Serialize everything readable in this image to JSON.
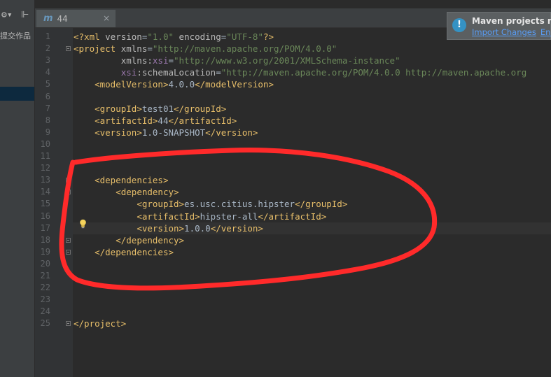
{
  "left_panel": {
    "label": "提交作品",
    "gear_icon": "gear-icon",
    "pin_icon": "pin-icon"
  },
  "tab": {
    "icon_letter": "m",
    "label": "44",
    "close_symbol": "×"
  },
  "notification": {
    "title": "Maven projects ne",
    "import_link": "Import Changes",
    "enable_link": "Ena"
  },
  "lines": [
    {
      "n": "1",
      "segs": [
        {
          "c": "t-pi",
          "t": "<?xml "
        },
        {
          "c": "t-attr",
          "t": "version"
        },
        {
          "c": "t-text",
          "t": "="
        },
        {
          "c": "t-val",
          "t": "\"1.0\""
        },
        {
          "c": "t-text",
          "t": " "
        },
        {
          "c": "t-attr",
          "t": "encoding"
        },
        {
          "c": "t-text",
          "t": "="
        },
        {
          "c": "t-val",
          "t": "\"UTF-8\""
        },
        {
          "c": "t-pi",
          "t": "?>"
        }
      ]
    },
    {
      "n": "2",
      "segs": [
        {
          "c": "t-tag",
          "t": "<project "
        },
        {
          "c": "t-attr",
          "t": "xmlns"
        },
        {
          "c": "t-text",
          "t": "="
        },
        {
          "c": "t-val",
          "t": "\"http://maven.apache.org/POM/4.0.0\""
        }
      ]
    },
    {
      "n": "3",
      "segs": [
        {
          "c": "t-text",
          "t": "         "
        },
        {
          "c": "t-attr",
          "t": "xmlns:"
        },
        {
          "c": "t-ns",
          "t": "xsi"
        },
        {
          "c": "t-text",
          "t": "="
        },
        {
          "c": "t-val",
          "t": "\"http://www.w3.org/2001/XMLSchema-instance\""
        }
      ]
    },
    {
      "n": "4",
      "segs": [
        {
          "c": "t-text",
          "t": "         "
        },
        {
          "c": "t-ns",
          "t": "xsi"
        },
        {
          "c": "t-attr",
          "t": ":schemaLocation"
        },
        {
          "c": "t-text",
          "t": "="
        },
        {
          "c": "t-val",
          "t": "\"http://maven.apache.org/POM/4.0.0 http://maven.apache.org"
        }
      ]
    },
    {
      "n": "5",
      "segs": [
        {
          "c": "t-text",
          "t": "    "
        },
        {
          "c": "t-tag",
          "t": "<modelVersion>"
        },
        {
          "c": "t-text",
          "t": "4.0.0"
        },
        {
          "c": "t-tag",
          "t": "</modelVersion>"
        }
      ]
    },
    {
      "n": "6",
      "segs": []
    },
    {
      "n": "7",
      "segs": [
        {
          "c": "t-text",
          "t": "    "
        },
        {
          "c": "t-tag",
          "t": "<groupId>"
        },
        {
          "c": "t-text",
          "t": "test01"
        },
        {
          "c": "t-tag",
          "t": "</groupId>"
        }
      ]
    },
    {
      "n": "8",
      "segs": [
        {
          "c": "t-text",
          "t": "    "
        },
        {
          "c": "t-tag",
          "t": "<artifactId>"
        },
        {
          "c": "t-text",
          "t": "44"
        },
        {
          "c": "t-tag",
          "t": "</artifactId>"
        }
      ]
    },
    {
      "n": "9",
      "segs": [
        {
          "c": "t-text",
          "t": "    "
        },
        {
          "c": "t-tag",
          "t": "<version>"
        },
        {
          "c": "t-text",
          "t": "1.0-SNAPSHOT"
        },
        {
          "c": "t-tag",
          "t": "</version>"
        }
      ]
    },
    {
      "n": "10",
      "segs": []
    },
    {
      "n": "11",
      "segs": []
    },
    {
      "n": "12",
      "segs": []
    },
    {
      "n": "13",
      "segs": [
        {
          "c": "t-text",
          "t": "    "
        },
        {
          "c": "t-tag",
          "t": "<dependencies>"
        }
      ]
    },
    {
      "n": "14",
      "segs": [
        {
          "c": "t-text",
          "t": "        "
        },
        {
          "c": "t-tag",
          "t": "<dependency>"
        }
      ]
    },
    {
      "n": "15",
      "segs": [
        {
          "c": "t-text",
          "t": "            "
        },
        {
          "c": "t-tag",
          "t": "<groupId>"
        },
        {
          "c": "t-text",
          "t": "es.usc.citius.hipster"
        },
        {
          "c": "t-tag",
          "t": "</groupId>"
        }
      ]
    },
    {
      "n": "16",
      "segs": [
        {
          "c": "t-text",
          "t": "            "
        },
        {
          "c": "t-tag",
          "t": "<artifactId>"
        },
        {
          "c": "t-text",
          "t": "hipster-all"
        },
        {
          "c": "t-tag",
          "t": "</artifactId>"
        }
      ]
    },
    {
      "n": "17",
      "segs": [
        {
          "c": "t-text",
          "t": "            "
        },
        {
          "c": "t-tag",
          "t": "<version>"
        },
        {
          "c": "t-text",
          "t": "1.0.0"
        },
        {
          "c": "t-tag",
          "t": "</version>"
        }
      ]
    },
    {
      "n": "18",
      "segs": [
        {
          "c": "t-text",
          "t": "        "
        },
        {
          "c": "t-tag",
          "t": "</dependency>"
        }
      ]
    },
    {
      "n": "19",
      "segs": [
        {
          "c": "t-text",
          "t": "    "
        },
        {
          "c": "t-tag",
          "t": "</dependencies>"
        }
      ]
    },
    {
      "n": "20",
      "segs": []
    },
    {
      "n": "21",
      "segs": []
    },
    {
      "n": "22",
      "segs": []
    },
    {
      "n": "23",
      "segs": []
    },
    {
      "n": "24",
      "segs": []
    },
    {
      "n": "25",
      "segs": [
        {
          "c": "t-tag",
          "t": "</project>"
        }
      ]
    }
  ],
  "current_line": "17",
  "folded_lines": [
    "2",
    "13",
    "14",
    "18",
    "19",
    "25"
  ],
  "annotation_color": "#ff2a2a"
}
